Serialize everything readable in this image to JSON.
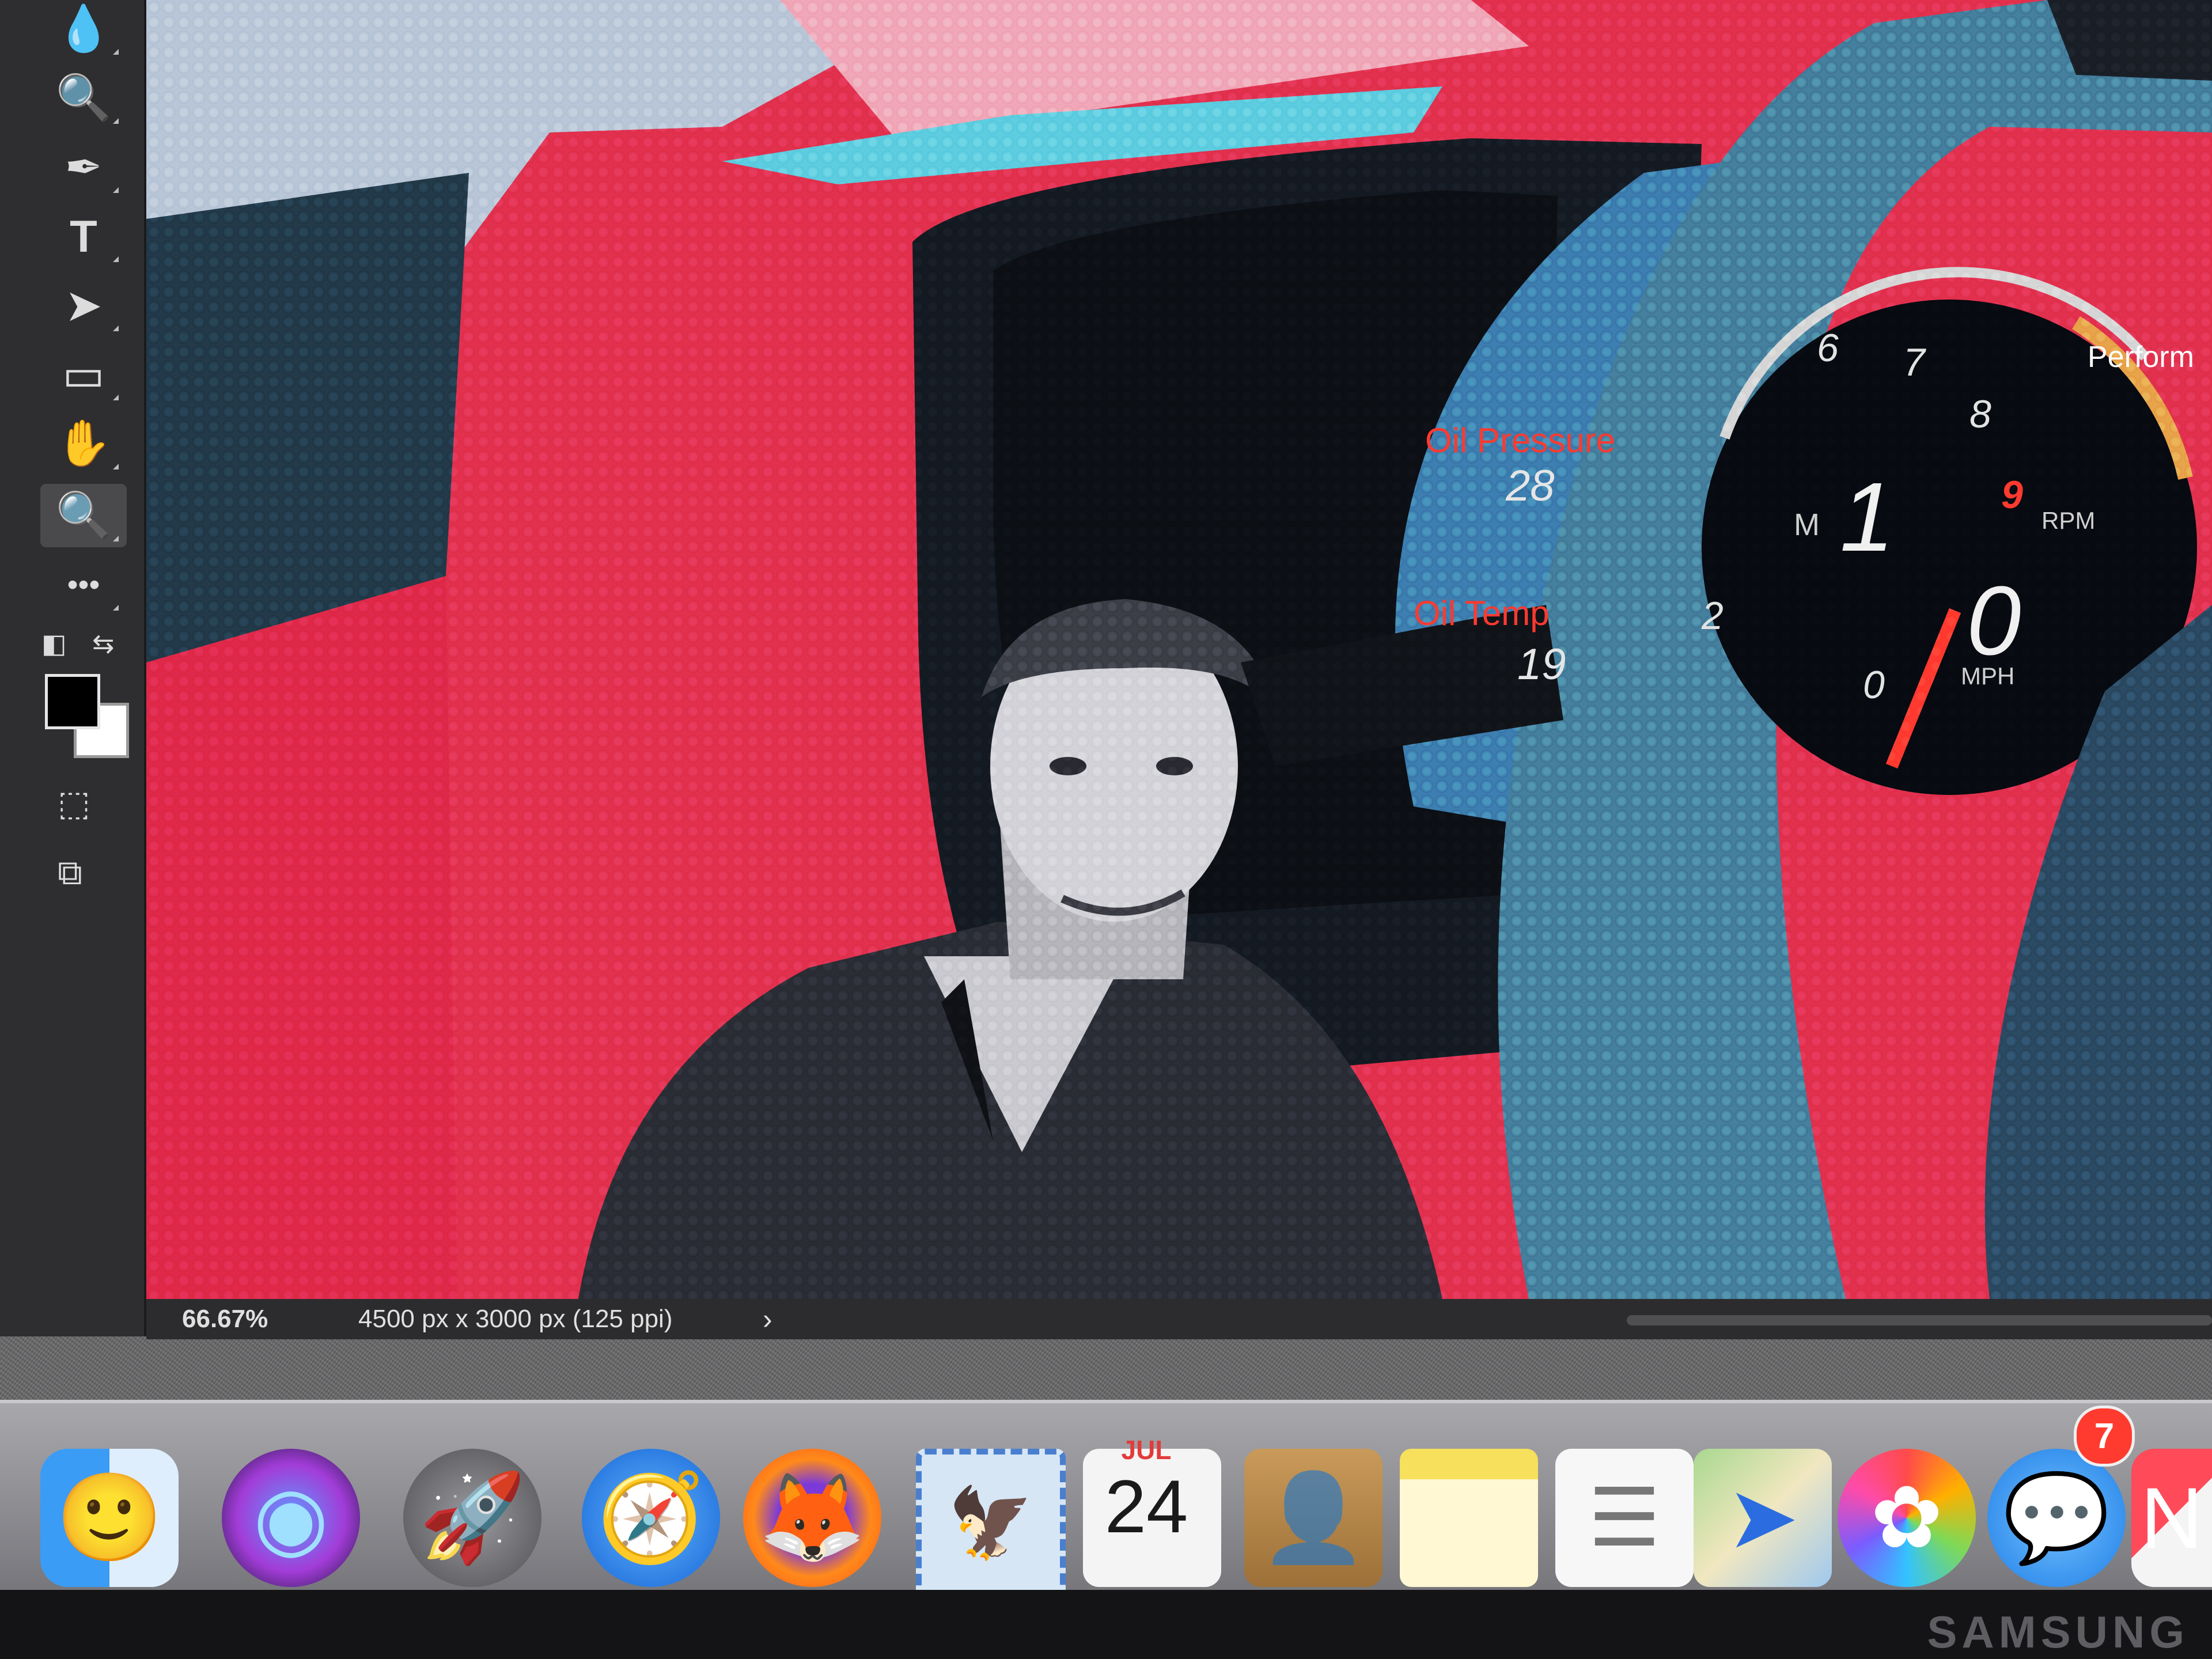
{
  "toolbar": {
    "tools": [
      {
        "name": "blur-tool-icon",
        "glyph": "💧"
      },
      {
        "name": "dodge-tool-icon",
        "glyph": "🔍"
      },
      {
        "name": "pen-tool-icon",
        "glyph": "✒"
      },
      {
        "name": "type-tool-icon",
        "glyph": "T"
      },
      {
        "name": "path-selection-tool-icon",
        "glyph": "➤"
      },
      {
        "name": "rectangle-tool-icon",
        "glyph": "▭"
      },
      {
        "name": "hand-tool-icon",
        "glyph": "✋"
      },
      {
        "name": "zoom-tool-icon",
        "glyph": "🔍"
      },
      {
        "name": "more-tools-icon",
        "glyph": "•••"
      }
    ],
    "active_tool": "zoom-tool-icon",
    "foreground_color": "#000000",
    "background_color": "#ffffff"
  },
  "status_bar": {
    "zoom": "66.67%",
    "document_info": "4500 px x 3000 px (125 ppi)",
    "chevron": "›"
  },
  "artwork": {
    "gauge_labels": [
      "6",
      "7",
      "8",
      "9",
      "M",
      "1",
      "2",
      "0",
      "0",
      "RPM",
      "MPH",
      "Perform"
    ],
    "cluster_labels": [
      "Oil Pressure",
      "28",
      "Oil Temp",
      "19"
    ]
  },
  "dock": {
    "apps": [
      {
        "name": "finder",
        "glyph": "🙂",
        "color": "#2f8cf0"
      },
      {
        "name": "siri",
        "glyph": "◉",
        "color": "#2b2b6a"
      },
      {
        "name": "launchpad",
        "glyph": "🚀",
        "color": "#6c6c70"
      },
      {
        "name": "safari",
        "glyph": "🧭",
        "color": "#1a74e8"
      },
      {
        "name": "firefox",
        "glyph": "🦊",
        "color": "#ff7a18"
      },
      {
        "name": "mail",
        "glyph": "🦅",
        "color": "#d6e6f5"
      },
      {
        "name": "calendar",
        "glyph": "",
        "color": "#f4f4f4"
      },
      {
        "name": "contacts",
        "glyph": "👤",
        "color": "#b58a4e"
      },
      {
        "name": "notes",
        "glyph": "",
        "color": "#fff6c2"
      },
      {
        "name": "reminders",
        "glyph": "☰",
        "color": "#f6f6f6"
      },
      {
        "name": "maps",
        "glyph": "➤",
        "color": "#cfe6c8"
      },
      {
        "name": "photos",
        "glyph": "✿",
        "color": "#f6f6f6"
      },
      {
        "name": "messages",
        "glyph": "💬",
        "color": "#4aa8ff"
      },
      {
        "name": "news",
        "glyph": "N",
        "color": "#f2f2f2"
      }
    ],
    "calendar_month": "JUL",
    "calendar_day": "24",
    "messages_badge": "7"
  },
  "monitor_brand": "SAMSUNG"
}
